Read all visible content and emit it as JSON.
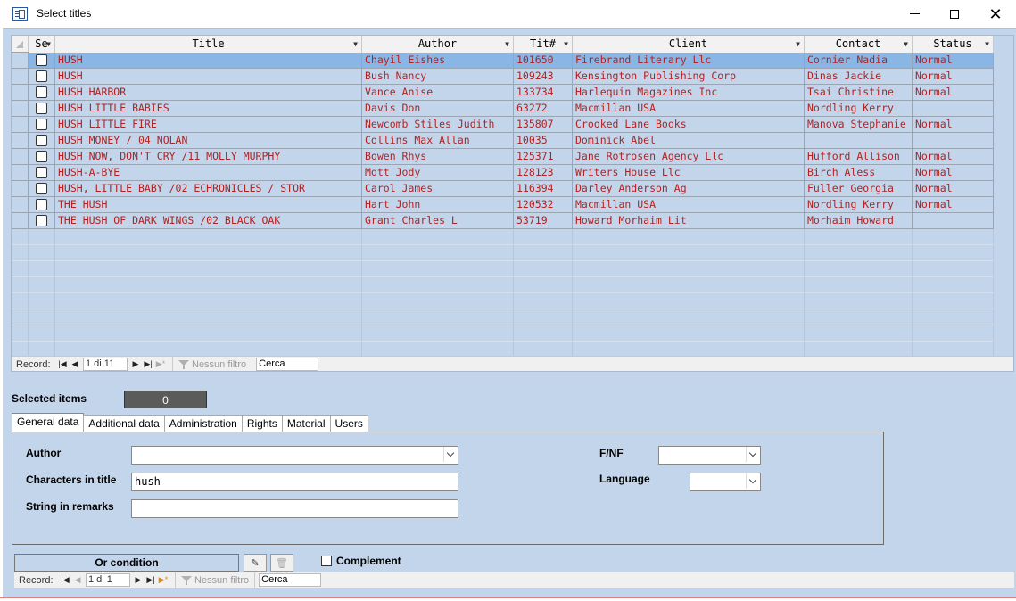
{
  "window": {
    "title": "Select titles"
  },
  "grid": {
    "columns": [
      {
        "label": "Se",
        "width": 30
      },
      {
        "label": "Title",
        "width": 344
      },
      {
        "label": "Author",
        "width": 170
      },
      {
        "label": "Tit#",
        "width": 66
      },
      {
        "label": "Client",
        "width": 260
      },
      {
        "label": "Contact",
        "width": 121
      },
      {
        "label": "Status",
        "width": 91
      }
    ],
    "rows": [
      {
        "title": "HUSH",
        "author": "Chayil Eishes",
        "tit": "101650",
        "client": "Firebrand Literary Llc",
        "contact": "Cornier Nadia",
        "status": "Normal",
        "selected": true
      },
      {
        "title": "HUSH",
        "author": "Bush Nancy",
        "tit": "109243",
        "client": "Kensington Publishing Corp",
        "contact": "Dinas Jackie",
        "status": "Normal"
      },
      {
        "title": "HUSH HARBOR",
        "author": "Vance Anise",
        "tit": "133734",
        "client": "Harlequin Magazines Inc",
        "contact": "Tsai Christine",
        "status": "Normal"
      },
      {
        "title": "HUSH LITTLE BABIES",
        "author": "Davis Don",
        "tit": "63272",
        "client": "Macmillan USA",
        "contact": "Nordling Kerry",
        "status": ""
      },
      {
        "title": "HUSH LITTLE FIRE",
        "author": "Newcomb Stiles Judith",
        "tit": "135807",
        "client": "Crooked Lane Books",
        "contact": "Manova Stephanie",
        "status": "Normal"
      },
      {
        "title": "HUSH MONEY / 04 NOLAN",
        "author": "Collins Max Allan",
        "tit": "10035",
        "client": "Dominick Abel",
        "contact": "",
        "status": ""
      },
      {
        "title": "HUSH NOW, DON'T CRY /11 MOLLY MURPHY",
        "author": "Bowen Rhys",
        "tit": "125371",
        "client": "Jane Rotrosen Agency Llc",
        "contact": "Hufford Allison",
        "status": "Normal"
      },
      {
        "title": "HUSH-A-BYE",
        "author": "Mott Jody",
        "tit": "128123",
        "client": "Writers House Llc",
        "contact": "Birch Aless",
        "status": "Normal"
      },
      {
        "title": "HUSH, LITTLE BABY /02 ECHRONICLES / STOR",
        "author": "Carol James",
        "tit": "116394",
        "client": "Darley Anderson Ag",
        "contact": "Fuller Georgia",
        "status": "Normal"
      },
      {
        "title": "THE HUSH",
        "author": "Hart John",
        "tit": "120532",
        "client": "Macmillan USA",
        "contact": "Nordling Kerry",
        "status": "Normal"
      },
      {
        "title": "THE HUSH OF DARK WINGS /02 BLACK OAK",
        "author": "Grant Charles L",
        "tit": "53719",
        "client": "Howard Morhaim Lit",
        "contact": "Morhaim Howard",
        "status": ""
      }
    ],
    "record_nav": {
      "label": "Record:",
      "position": "1 di 11",
      "filter": "Nessun filtro",
      "search": "Cerca"
    }
  },
  "selected_items": {
    "label": "Selected items",
    "count": "0"
  },
  "tabs": [
    "General data",
    "Additional data",
    "Administration",
    "Rights",
    "Material",
    "Users"
  ],
  "form": {
    "author_label": "Author",
    "author_value": "",
    "chars_label": "Characters in title",
    "chars_value": "hush",
    "remarks_label": "String in remarks",
    "remarks_value": "",
    "fnf_label": "F/NF",
    "fnf_value": "",
    "language_label": "Language",
    "language_value": ""
  },
  "bottom": {
    "or_condition": "Or condition",
    "complement": "Complement",
    "record_nav": {
      "label": "Record:",
      "position": "1 di 1",
      "filter": "Nessun filtro",
      "search": "Cerca"
    }
  }
}
